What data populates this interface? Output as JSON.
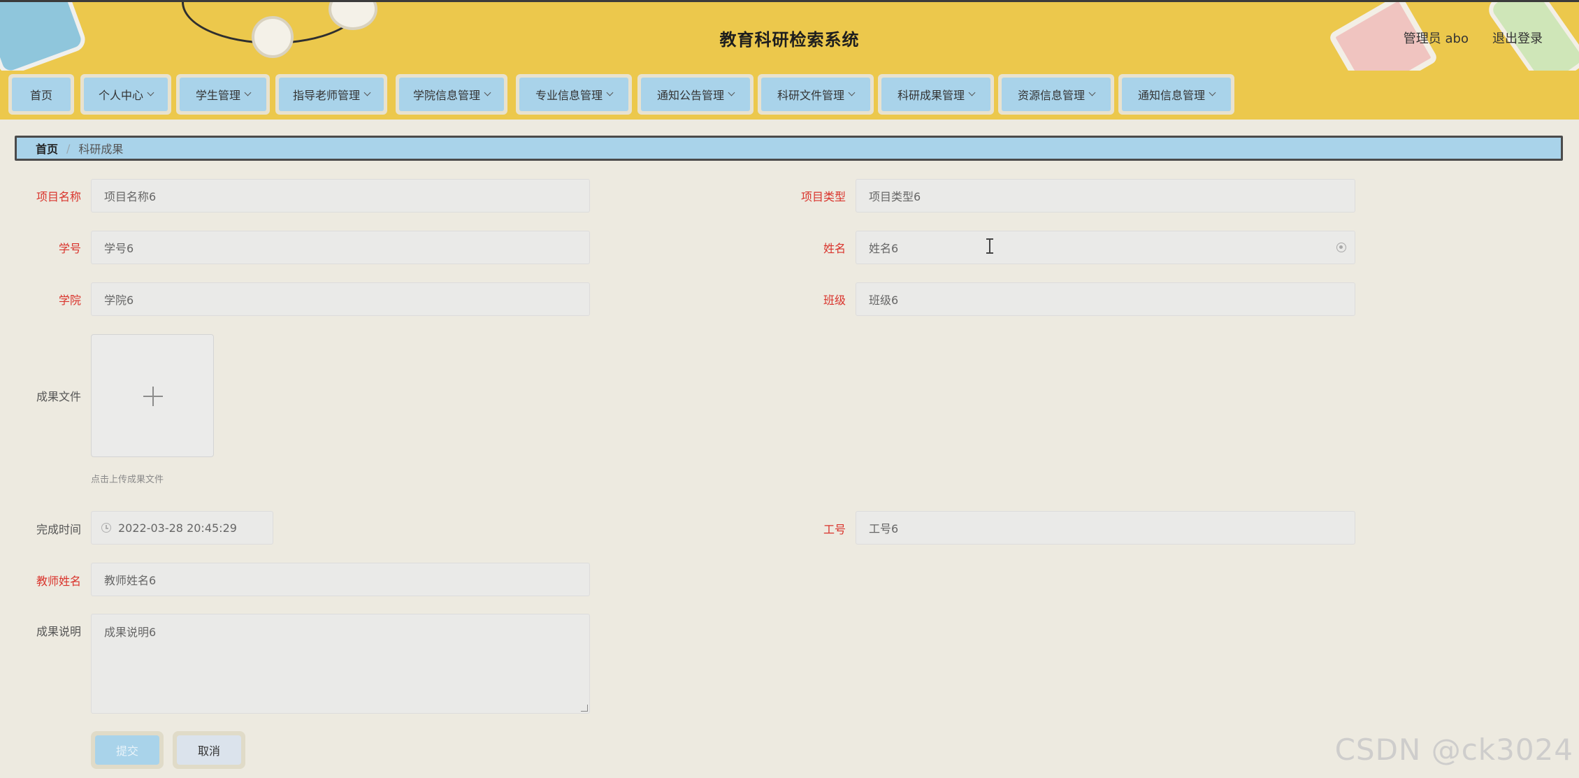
{
  "header": {
    "title": "教育科研检索系统",
    "user": "管理员 abo",
    "logout": "退出登录"
  },
  "nav": {
    "items": [
      {
        "label": "首页",
        "dropdown": false
      },
      {
        "label": "个人中心",
        "dropdown": true
      },
      {
        "label": "学生管理",
        "dropdown": true
      },
      {
        "label": "指导老师管理",
        "dropdown": true
      },
      {
        "label": "学院信息管理",
        "dropdown": true
      },
      {
        "label": "专业信息管理",
        "dropdown": true
      },
      {
        "label": "通知公告管理",
        "dropdown": true
      },
      {
        "label": "科研文件管理",
        "dropdown": true
      },
      {
        "label": "科研成果管理",
        "dropdown": true
      },
      {
        "label": "资源信息管理",
        "dropdown": true
      },
      {
        "label": "通知信息管理",
        "dropdown": true
      }
    ]
  },
  "breadcrumb": {
    "home": "首页",
    "separator": "/",
    "current": "科研成果"
  },
  "form": {
    "project_name": {
      "label": "项目名称",
      "value": "项目名称6"
    },
    "project_type": {
      "label": "项目类型",
      "value": "项目类型6"
    },
    "student_no": {
      "label": "学号",
      "value": "学号6"
    },
    "name": {
      "label": "姓名",
      "value": "姓名6"
    },
    "college": {
      "label": "学院",
      "value": "学院6"
    },
    "class": {
      "label": "班级",
      "value": "班级6"
    },
    "result_file": {
      "label": "成果文件",
      "hint": "点击上传成果文件"
    },
    "finish_time": {
      "label": "完成时间",
      "value": "2022-03-28 20:45:29"
    },
    "staff_no": {
      "label": "工号",
      "value": "工号6"
    },
    "teacher_name": {
      "label": "教师姓名",
      "value": "教师姓名6"
    },
    "result_desc": {
      "label": "成果说明",
      "value": "成果说明6"
    },
    "submit": "提交",
    "cancel": "取消"
  },
  "watermark": "CSDN @ck3024",
  "colors": {
    "header_bg": "#ecc84c",
    "nav_item_bg": "#a9d3ea",
    "required_label": "#d9332b",
    "page_bg": "#edeae0"
  }
}
